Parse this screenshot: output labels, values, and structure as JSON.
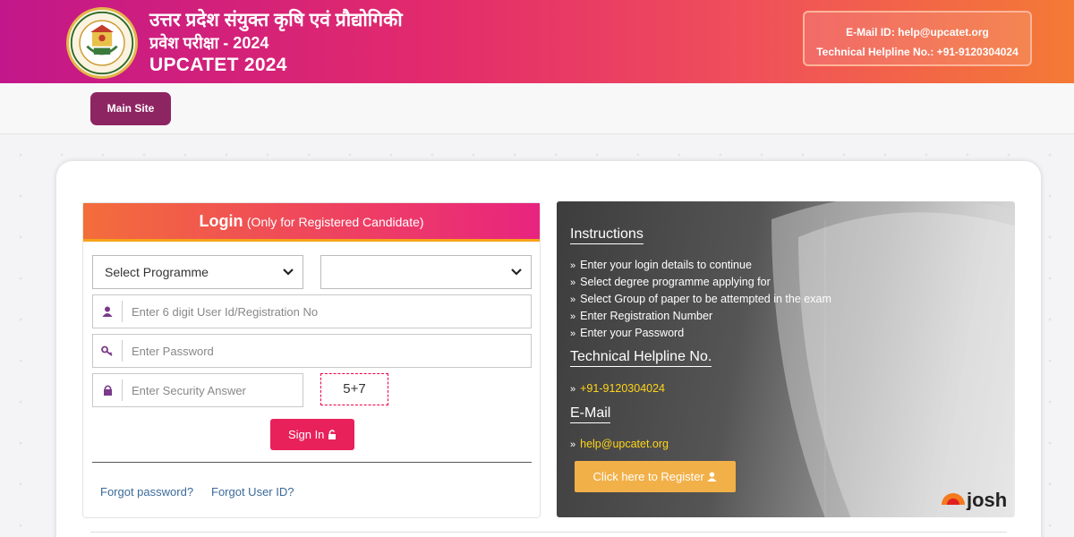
{
  "header": {
    "title_hindi_line1": "उत्तर प्रदेश संयुक्त कृषि एवं प्रौद्योगिकी",
    "title_hindi_line2": "प्रवेश परीक्षा - 2024",
    "title_english": "UPCATET 2024",
    "email_label": "E-Mail ID: help@upcatet.org",
    "helpline_label": "Technical Helpline No.: +91-9120304024"
  },
  "nav": {
    "main_site": "Main Site"
  },
  "login": {
    "title": "Login",
    "subtitle": "(Only for Registered Candidate)",
    "programme_select": "Select Programme",
    "group_select": "",
    "userid_placeholder": "Enter 6 digit User Id/Registration No",
    "password_placeholder": "Enter Password",
    "security_placeholder": "Enter Security Answer",
    "captcha": "5+7",
    "signin": "Sign In",
    "forgot_password": "Forgot password?",
    "forgot_userid": "Forgot User ID?"
  },
  "info": {
    "instructions_title": "Instructions",
    "instructions": [
      "Enter your login details to continue",
      "Select degree programme applying for",
      "Select Group of paper to be attempted in the exam",
      "Enter Registration Number",
      "Enter your Password"
    ],
    "helpline_title": "Technical Helpline No.",
    "helpline_number": "+91-9120304024",
    "email_title": "E-Mail",
    "email": "help@upcatet.org",
    "register_button": "Click here to Register",
    "watermark": "josh"
  },
  "colors": {
    "header_gradient_start": "#c2178a",
    "header_gradient_end": "#f47a35",
    "main_site_button": "#8e2563",
    "signin_button": "#e8215b",
    "register_button": "#f2b048",
    "accent_yellow": "#ffd51a"
  }
}
